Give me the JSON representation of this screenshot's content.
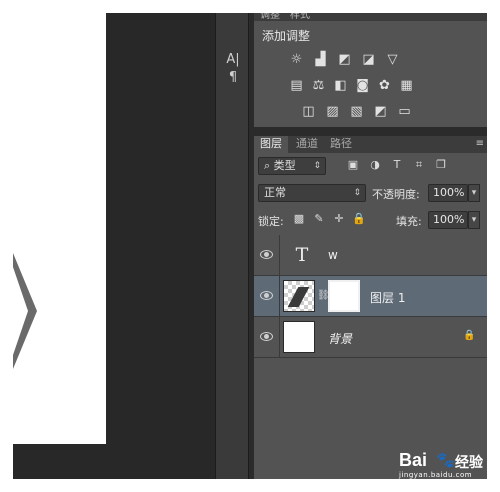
{
  "tool_strip": {
    "buttons": [
      {
        "icon": "character-icon",
        "glyph": "A|"
      },
      {
        "icon": "paragraph-icon",
        "glyph": "¶"
      }
    ]
  },
  "adjustments": {
    "tabs": [
      "调整",
      "样式"
    ],
    "title": "添加调整",
    "icons": [
      [
        "brightness-icon",
        "levels-icon",
        "curves-icon",
        "exposure-icon",
        "gradient-triangle-icon"
      ],
      [
        "vibrance-icon",
        "color-balance-icon",
        "black-white-icon",
        "photo-filter-icon",
        "channel-mixer-icon",
        "color-lookup-icon"
      ],
      [
        "invert-icon",
        "posterize-icon",
        "threshold-icon",
        "selective-color-icon",
        "gradient-map-icon"
      ]
    ]
  },
  "layers": {
    "tabs": [
      {
        "label": "图层",
        "active": true
      },
      {
        "label": "通道",
        "active": false
      },
      {
        "label": "路径",
        "active": false
      }
    ],
    "filter_kind": "类型",
    "blend_mode": "正常",
    "opacity_label": "不透明度:",
    "opacity_value": "100%",
    "lock_label": "锁定:",
    "fill_label": "填充:",
    "fill_value": "100%",
    "items": [
      {
        "name": "w",
        "kind": "text",
        "selected": false,
        "locked": false
      },
      {
        "name": "图层 1",
        "kind": "shape-with-mask",
        "selected": true,
        "locked": false
      },
      {
        "name": "背景",
        "kind": "background",
        "selected": false,
        "locked": true
      }
    ]
  },
  "baidu_watermark": {
    "logo": "Bai",
    "suffix": "经验",
    "url": "jingyan.baidu.com"
  },
  "colors": {
    "panel_bg": "#535353",
    "selected_layer": "#5f6a77",
    "canvas_bg": "#282828"
  }
}
